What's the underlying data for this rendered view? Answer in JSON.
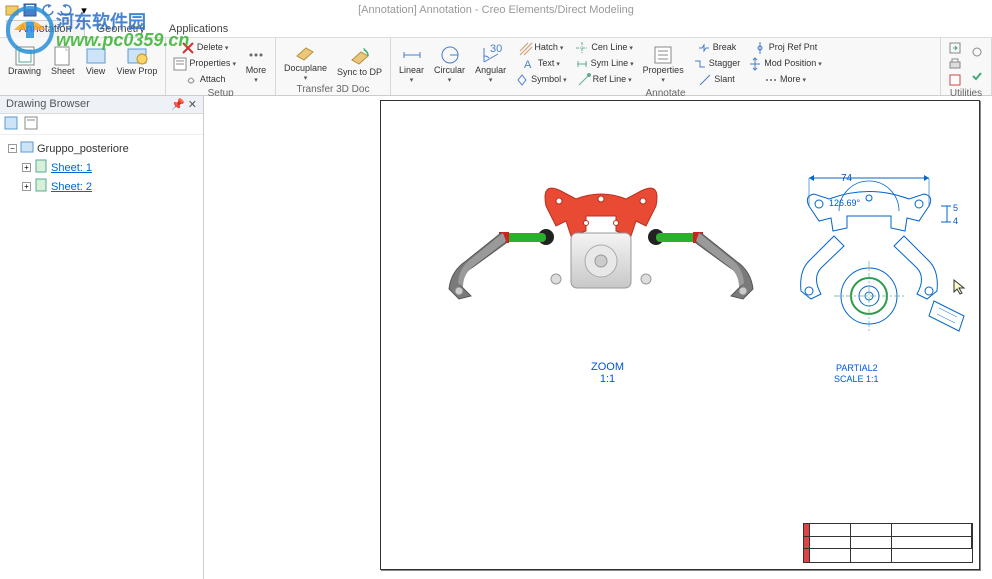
{
  "title": "[Annotation]  Annotation - Creo Elements/Direct Modeling",
  "tabs": {
    "annotation": "Annotation",
    "geometry": "Geometry",
    "applications": "Applications"
  },
  "ribbon": {
    "new": {
      "drawing": "Drawing",
      "sheet": "Sheet",
      "view": "View",
      "viewprops": "View\nProp"
    },
    "setup": {
      "delete": "Delete",
      "properties": "Properties",
      "attach": "Attach",
      "more": "More",
      "docuplane": "Docuplane",
      "sync": "Sync\nto DP",
      "group_label": "Setup",
      "transfer_label": "Transfer 3D Doc"
    },
    "annotate": {
      "linear": "Linear",
      "circular": "Circular",
      "angular": "Angular",
      "hatch": "Hatch",
      "text": "Text",
      "symbol": "Symbol",
      "cenline": "Cen Line",
      "symline": "Sym Line",
      "refline": "Ref Line",
      "properties": "Properties",
      "break": "Break",
      "stagger": "Stagger",
      "slant": "Slant",
      "projrefpnt": "Proj Ref Pnt",
      "modposition": "Mod Position",
      "more": "More",
      "group_label": "Annotate"
    },
    "utilities": {
      "group_label": "Utilities"
    }
  },
  "browser": {
    "title": "Drawing Browser",
    "root": "Gruppo_posteriore",
    "sheet1": "Sheet: 1",
    "sheet2": "Sheet: 2"
  },
  "drawing": {
    "detail_name": "PARTIAL2",
    "detail_scale": "SCALE  1:1",
    "dim1": "74",
    "angle1": "126.69°",
    "dim2": "5",
    "dim3": "4",
    "main_zoom": "ZOOM",
    "main_scale": "1:1"
  },
  "watermark": {
    "site": "河东软件园",
    "url": "www.pc0359.cn"
  }
}
